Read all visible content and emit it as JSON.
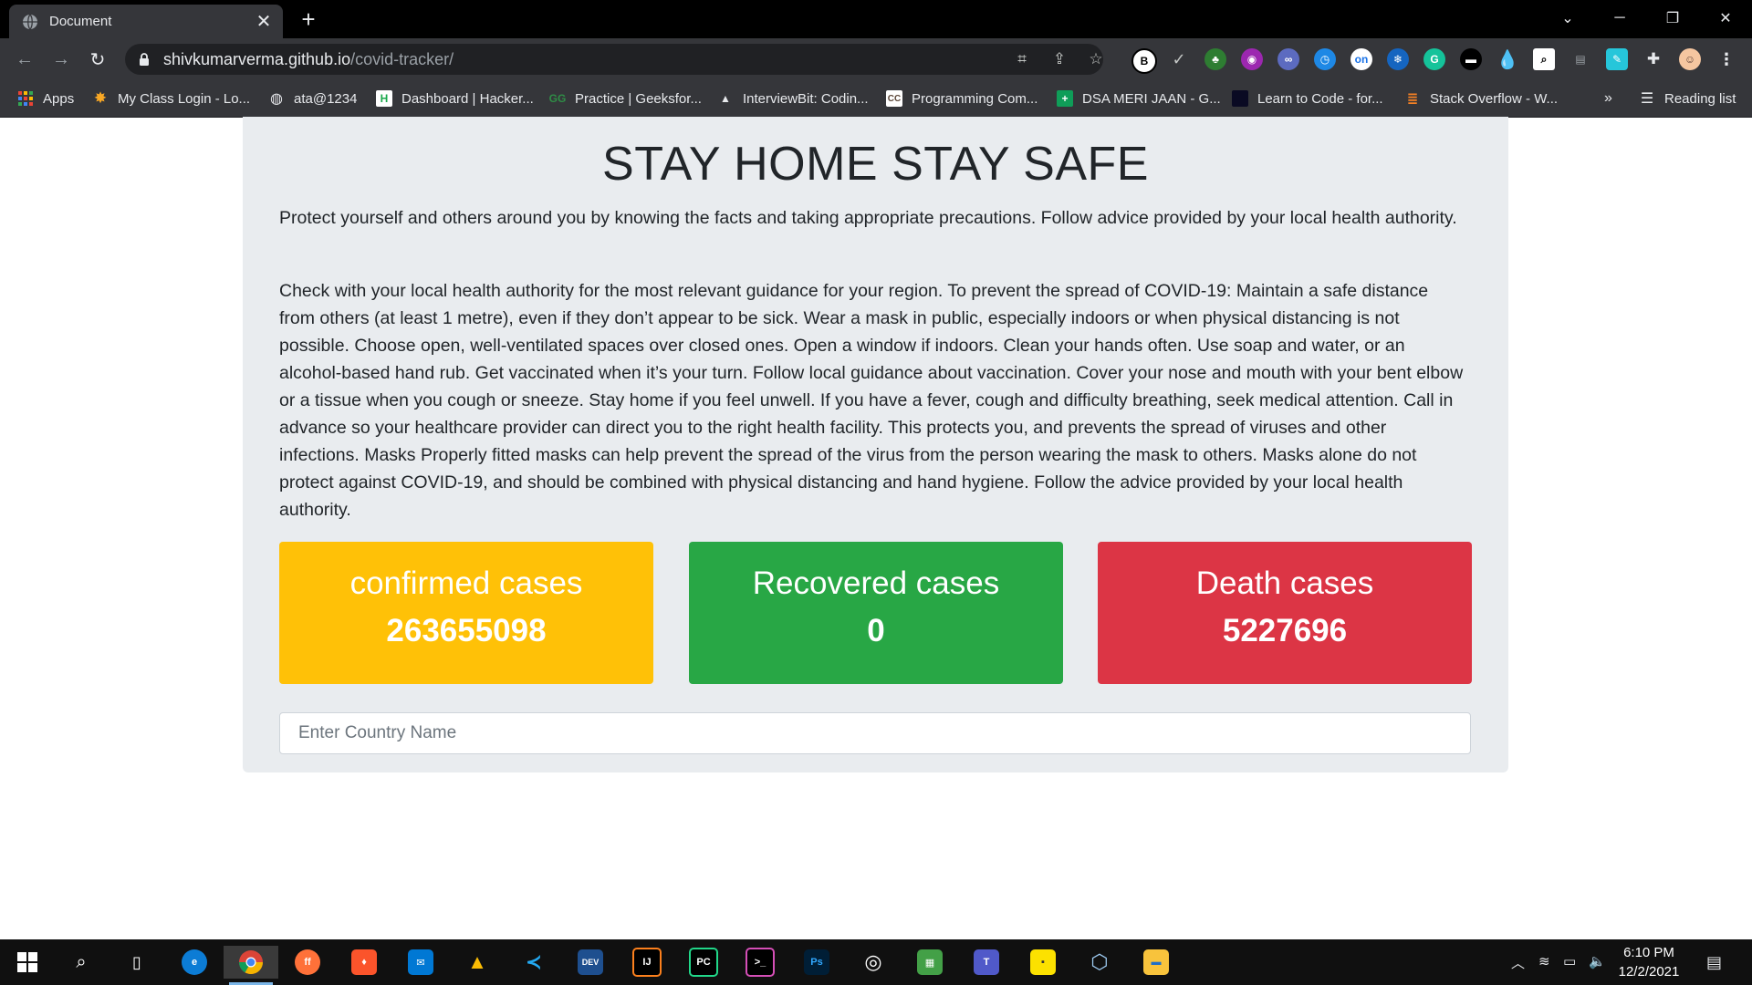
{
  "browser": {
    "tab_title": "Document",
    "url_host": "shivkumarverma.github.io",
    "url_path": "/covid-tracker/"
  },
  "bookmarks": [
    {
      "label": "Apps",
      "icon": "apps-grid-icon"
    },
    {
      "label": "My Class Login - Lo...",
      "icon": "myclass-icon"
    },
    {
      "label": "ata@1234",
      "icon": "globe-icon"
    },
    {
      "label": "Dashboard | Hacker...",
      "icon": "hackerrank-icon"
    },
    {
      "label": "Practice | Geeksfor...",
      "icon": "geeksforgeeks-icon"
    },
    {
      "label": "InterviewBit: Codin...",
      "icon": "interviewbit-icon"
    },
    {
      "label": "Programming Com...",
      "icon": "codechef-icon"
    },
    {
      "label": "DSA MERI JAAN - G...",
      "icon": "google-sheets-icon"
    },
    {
      "label": "Learn to Code - for...",
      "icon": "freecodecamp-icon"
    },
    {
      "label": "Stack Overflow - W...",
      "icon": "stackoverflow-icon"
    }
  ],
  "bookmarks_overflow": "»",
  "reading_list": "Reading list",
  "page": {
    "title": "STAY HOME STAY SAFE",
    "paragraph1": "Protect yourself and others around you by knowing the facts and taking appropriate precautions. Follow advice provided by your local health authority.",
    "paragraph2": "Check with your local health authority for the most relevant guidance for your region. To prevent the spread of COVID-19: Maintain a safe distance from others (at least 1 metre), even if they don’t appear to be sick. Wear a mask in public, especially indoors or when physical distancing is not possible. Choose open, well-ventilated spaces over closed ones. Open a window if indoors. Clean your hands often. Use soap and water, or an alcohol-based hand rub. Get vaccinated when it’s your turn. Follow local guidance about vaccination. Cover your nose and mouth with your bent elbow or a tissue when you cough or sneeze. Stay home if you feel unwell. If you have a fever, cough and difficulty breathing, seek medical attention. Call in advance so your healthcare provider can direct you to the right health facility. This protects you, and prevents the spread of viruses and other infections. Masks Properly fitted masks can help prevent the spread of the virus from the person wearing the mask to others. Masks alone do not protect against COVID-19, and should be combined with physical distancing and hand hygiene. Follow the advice provided by your local health authority.",
    "cards": {
      "confirmed": {
        "label": "confirmed cases",
        "value": "263655098",
        "color": "#ffc107"
      },
      "recovered": {
        "label": "Recovered cases",
        "value": "0",
        "color": "#28a745"
      },
      "deaths": {
        "label": "Death cases",
        "value": "5227696",
        "color": "#dc3545"
      }
    },
    "search": {
      "placeholder": "Enter Country Name",
      "value": ""
    }
  },
  "taskbar": {
    "time": "6:10 PM",
    "date": "12/2/2021"
  }
}
